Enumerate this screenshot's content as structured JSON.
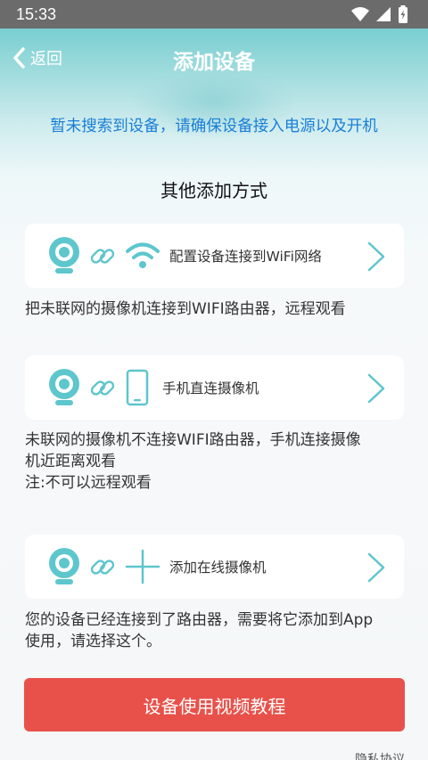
{
  "status": {
    "time": "15:33"
  },
  "nav": {
    "back_label": "返回",
    "title": "添加设备"
  },
  "hint": "暂未搜索到设备，请确保设备接入电源以及开机",
  "section_title": "其他添加方式",
  "options": [
    {
      "label": "配置设备连接到WiFi网络",
      "desc": "把未联网的摄像机连接到WIFI路由器，远程观看"
    },
    {
      "label": "手机直连摄像机",
      "desc1": "未联网的摄像机不连接WIFI路由器，手机连接摄像",
      "desc2": "机近距离观看",
      "desc3": "注:不可以远程观看"
    },
    {
      "label": "添加在线摄像机",
      "desc1": "您的设备已经连接到了路由器，需要将它添加到App",
      "desc2": "使用，请选择这个。"
    }
  ],
  "video_button": "设备使用视频教程",
  "bottom_link": "隐私协议",
  "colors": {
    "accent": "#5ec6cd",
    "hint": "#1a7fd6",
    "button": "#e8514a"
  }
}
